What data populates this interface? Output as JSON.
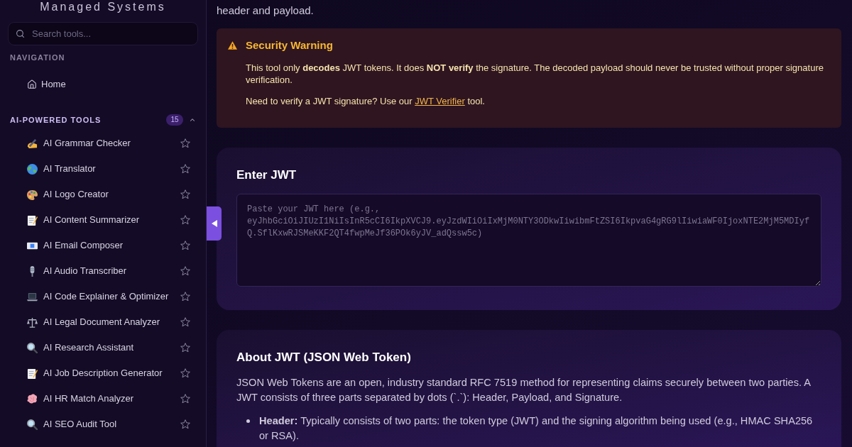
{
  "sidebar": {
    "title": "Managed Systems",
    "search": {
      "placeholder": "Search tools..."
    },
    "navigation": {
      "heading": "NAVIGATION",
      "items": [
        {
          "label": "Home"
        }
      ]
    },
    "tool_group": {
      "heading": "AI-POWERED TOOLS",
      "count": "15",
      "expanded": true,
      "items": [
        {
          "label": "AI Grammar Checker",
          "favorite": false
        },
        {
          "label": "AI Translator",
          "favorite": false
        },
        {
          "label": "AI Logo Creator",
          "favorite": false
        },
        {
          "label": "AI Content Summarizer",
          "favorite": false
        },
        {
          "label": "AI Email Composer",
          "favorite": false
        },
        {
          "label": "AI Audio Transcriber",
          "favorite": false
        },
        {
          "label": "AI Code Explainer & Optimizer",
          "favorite": false
        },
        {
          "label": "AI Legal Document Analyzer",
          "favorite": false
        },
        {
          "label": "AI Research Assistant",
          "favorite": false
        },
        {
          "label": "AI Job Description Generator",
          "favorite": false
        },
        {
          "label": "AI HR Match Analyzer",
          "favorite": false
        },
        {
          "label": "AI SEO Audit Tool",
          "favorite": false
        }
      ]
    }
  },
  "main": {
    "intro": "header and payload.",
    "warning": {
      "title": "Security Warning",
      "body": "This tool only **decodes** JWT tokens. It does **NOT verify** the signature. The decoded payload should never be trusted without proper signature verification.",
      "verify_hint": {
        "before": "Need to verify a JWT signature? Use our",
        "link": "JWT Verifier",
        "after": "tool."
      }
    },
    "input_card": {
      "heading": "Enter JWT",
      "textarea": {
        "placeholder": "Paste your JWT here (e.g., eyJhbGciOiJIUzI1NiIsInR5cCI6IkpXVCJ9.eyJzdWIiOiIxMjM0NTY3ODkwIiwibmFtZSI6IkpvaG4gRG9lIiwiaWF0IjoxNTE2MjM5MDIyfQ.SflKxwRJSMeKKF2QT4fwpMeJf36POk6yJV_adQssw5c)"
      }
    },
    "about_card": {
      "heading": "About JWT (JSON Web Token)",
      "paragraph": "JSON Web Tokens are an open, industry standard RFC 7519 method for representing claims securely between two parties. A JWT consists of three parts separated by dots (`.`): Header, Payload, and Signature.",
      "bullets": [
        "**Header:** Typically consists of two parts: the token type (JWT) and the signing algorithm being used (e.g., HMAC SHA256 or RSA)."
      ]
    }
  }
}
